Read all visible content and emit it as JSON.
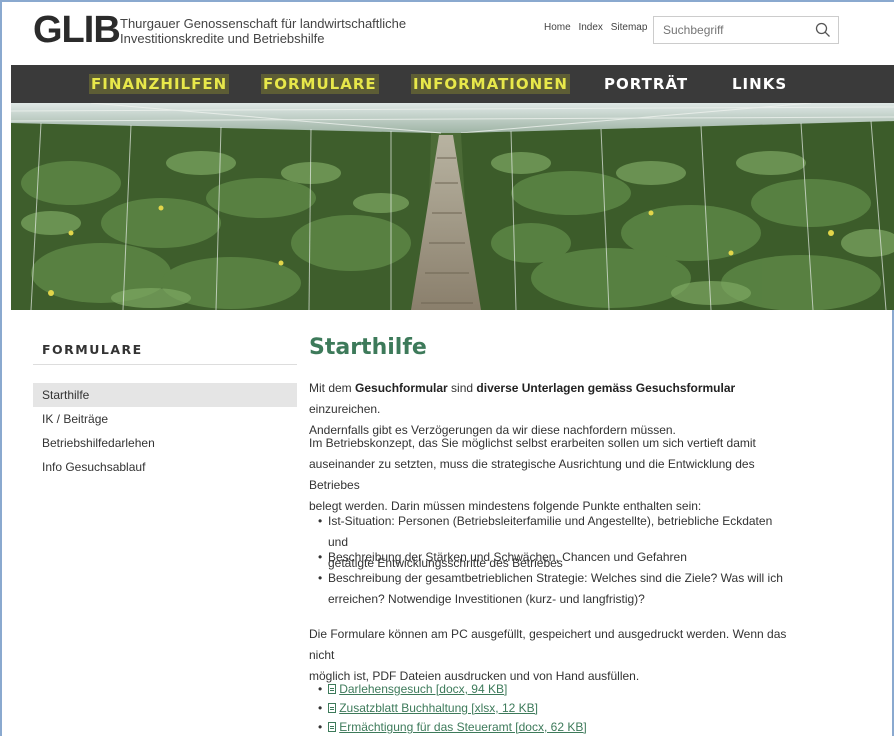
{
  "header": {
    "logo": "GLIB",
    "tagline_line1": "Thurgauer Genossenschaft für landwirtschaftliche",
    "tagline_line2": "Investitionskredite und Betriebshilfe",
    "links": [
      "Home",
      "Index",
      "Sitemap"
    ],
    "search_placeholder": "Suchbegriff"
  },
  "nav": {
    "items": [
      "FINANZHILFEN",
      "FORMULARE",
      "INFORMATIONEN",
      "PORTRÄT",
      "LINKS"
    ],
    "highlight_color": "#e8e84a",
    "background": "#3a3a3a"
  },
  "sidebar": {
    "title": "FORMULARE",
    "items": [
      "Starthilfe",
      "IK / Beiträge",
      "Betriebshilfedarlehen",
      "Info Gesuchsablauf"
    ],
    "active_index": 0
  },
  "main": {
    "title": "Starthilfe",
    "p1_a": "Mit dem ",
    "p1_b": "Gesuchformular",
    "p1_c": " sind ",
    "p1_d": "diverse Unterlagen gemäss Gesuchsformular",
    "p1_e": " einzureichen.",
    "p1_line2": "Andernfalls gibt es Verzögerungen da wir diese nachfordern müssen.",
    "p2_line1": "Im Betriebskonzept, das Sie möglichst selbst erarbeiten sollen um sich vertieft damit",
    "p2_line2": "auseinander zu setzten, muss die strategische Ausrichtung und die Entwicklung des Betriebes",
    "p2_line3": "belegt werden. Darin müssen mindestens folgende Punkte enthalten sein:",
    "bullets": [
      [
        "Ist-Situation: Personen (Betriebsleiterfamilie und Angestellte), betriebliche Eckdaten und",
        "getätigte Entwicklungsschritte des Betriebes"
      ],
      [
        "Beschreibung der Stärken und Schwächen, Chancen und Gefahren"
      ],
      [
        "Beschreibung der gesamtbetrieblichen Strategie: Welches sind die Ziele? Was will ich",
        "erreichen? Notwendige Investitionen (kurz- und langfristig)?"
      ]
    ],
    "p3_line1": "Die Formulare können am PC ausgefüllt, gespeichert und ausgedruckt werden. Wenn das nicht",
    "p3_line2": "möglich ist, PDF Dateien ausdrucken und von Hand ausfüllen.",
    "downloads": [
      "Darlehensgesuch [docx, 94 KB]",
      "Zusatzblatt Buchhaltung [xlsx, 12 KB]",
      "Ermächtigung für das Steueramt [docx, 62 KB]"
    ],
    "link_color": "#3d7a5a",
    "title_color": "#3d7a5a"
  }
}
